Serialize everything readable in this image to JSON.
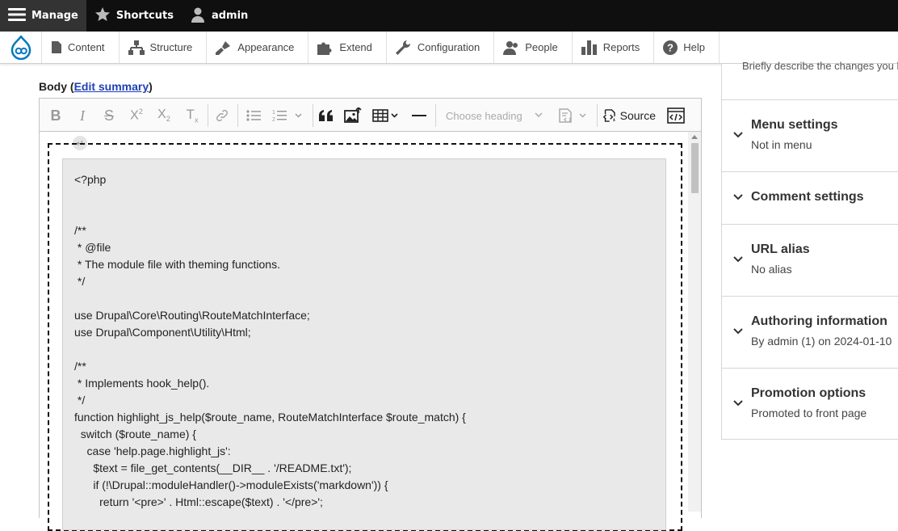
{
  "toolbar": {
    "manage": "Manage",
    "shortcuts": "Shortcuts",
    "user": "admin"
  },
  "tray": {
    "items": [
      {
        "label": "Content",
        "icon": "file-icon"
      },
      {
        "label": "Structure",
        "icon": "structure-icon"
      },
      {
        "label": "Appearance",
        "icon": "brush-icon"
      },
      {
        "label": "Extend",
        "icon": "puzzle-icon"
      },
      {
        "label": "Configuration",
        "icon": "wrench-icon"
      },
      {
        "label": "People",
        "icon": "people-icon"
      },
      {
        "label": "Reports",
        "icon": "bar-chart-icon"
      },
      {
        "label": "Help",
        "icon": "help-icon"
      }
    ]
  },
  "body_field": {
    "label": "Body",
    "edit_summary": "Edit summary"
  },
  "editor": {
    "heading_placeholder": "Choose heading",
    "source_label": "Source",
    "code_lines": [
      "<?php",
      "",
      "",
      "/**",
      " * @file",
      " * The module file with theming functions.",
      " */",
      "",
      "use Drupal\\Core\\Routing\\RouteMatchInterface;",
      "use Drupal\\Component\\Utility\\Html;",
      "",
      "/**",
      " * Implements hook_help().",
      " */",
      "function highlight_js_help($route_name, RouteMatchInterface $route_match) {",
      "  switch ($route_name) {",
      "    case 'help.page.highlight_js':",
      "      $text = file_get_contents(__DIR__ . '/README.txt');",
      "      if (!\\Drupal::moduleHandler()->moduleExists('markdown')) {",
      "        return '<pre>' . Html::escape($text) . '</pre>';"
    ]
  },
  "sidebar": {
    "top_text": "Briefly describe the changes you h",
    "sections": [
      {
        "title": "Menu settings",
        "summary": "Not in menu"
      },
      {
        "title": "Comment settings",
        "summary": ""
      },
      {
        "title": "URL alias",
        "summary": "No alias"
      },
      {
        "title": "Authoring information",
        "summary": "By admin (1) on 2024-01-10"
      },
      {
        "title": "Promotion options",
        "summary": "Promoted to front page"
      }
    ]
  },
  "colors": {
    "toolbar_bg": "#0f0f0f",
    "drupal_blue": "#0678be",
    "link": "#1f3fb5"
  }
}
